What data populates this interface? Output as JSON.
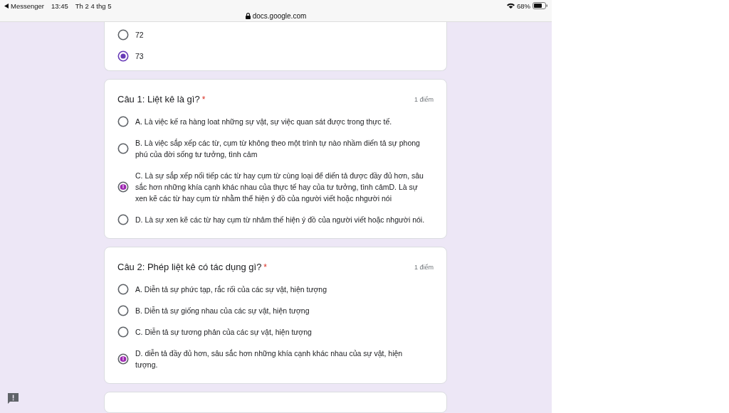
{
  "status_bar": {
    "back_app": "Messenger",
    "time": "13:45",
    "date": "Th 2 4 thg 5",
    "url": "docs.google.com",
    "battery": "68%"
  },
  "questions": [
    {
      "partial": true,
      "options": [
        {
          "label": "72",
          "selected": false,
          "scribbled": false
        },
        {
          "label": "73",
          "selected": true,
          "scribbled": false
        }
      ]
    },
    {
      "partial": false,
      "title": "Câu 1: Liệt kê là gì?",
      "required_mark": "*",
      "points": "1 điểm",
      "options": [
        {
          "label": "A. Là việc kế ra hàng loat những sự vật, sự việc quan sát được trong thực tế.",
          "selected": false,
          "scribbled": false
        },
        {
          "label": "B. Là việc sắp xếp các từ, cụm từ không theo một trình tự nào nhầm diến tả sự phong phú của đời sống tư tưởng, tình cảm",
          "selected": false,
          "scribbled": false
        },
        {
          "label": "C. Là sự sắp xếp nối tiếp các từ hay cụm từ cùng loại để diến tả được đầy đủ hơn, sâu sắc hơn những khía cạnh khác nhau của thực tế hay của tư tưởng, tình cảmD. Là sự xen kẽ các từ hay cụm từ nhằm thể hiện ý đồ của người viết hoặc nhgười nói",
          "selected": false,
          "scribbled": true
        },
        {
          "label": "D. Là sự xen kẽ các từ hay cụm từ nhâm thế hiện ý đồ của người viết hoặc nhgười nói.",
          "selected": false,
          "scribbled": false
        }
      ]
    },
    {
      "partial": false,
      "title": "Câu 2: Phép liệt kê có tác dụng gì?",
      "required_mark": "*",
      "points": "1 điểm",
      "options": [
        {
          "label": "A. Diễn tả sự phức tạp, rắc rối của các sự vật, hiện tượng",
          "selected": false,
          "scribbled": false
        },
        {
          "label": "B. Diễn tả sự giống nhau của các sự vật, hiện tượng",
          "selected": false,
          "scribbled": false
        },
        {
          "label": "C. Diễn tả sự tương phản của các sự vật, hiện tượng",
          "selected": false,
          "scribbled": false
        },
        {
          "label": "D. diễn tả đầy đủ hơn, sâu sắc hơn những khía cạnh khác nhau của sự vật, hiện tượng.",
          "selected": false,
          "scribbled": true
        }
      ]
    }
  ]
}
